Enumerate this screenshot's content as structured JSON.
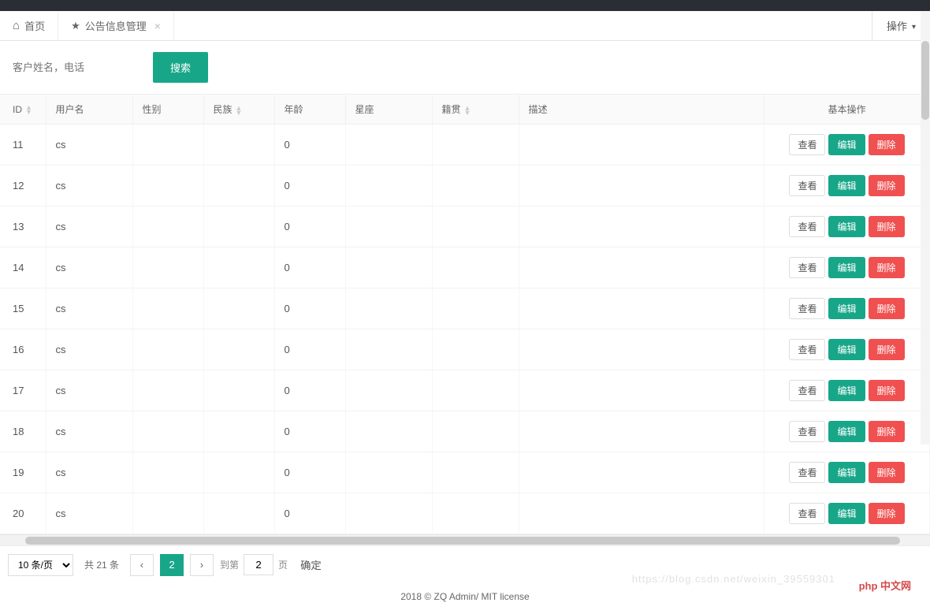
{
  "tabs": {
    "home": "首页",
    "active": "公告信息管理"
  },
  "operation_btn": "操作",
  "search": {
    "placeholder": "客户姓名，电话",
    "button": "搜索"
  },
  "columns": {
    "id": "ID",
    "username": "用户名",
    "gender": "性别",
    "ethnic": "民族",
    "age": "年龄",
    "zodiac": "星座",
    "origin": "籍贯",
    "desc": "描述",
    "ops": "基本操作"
  },
  "rows": [
    {
      "id": "11",
      "username": "cs",
      "gender": "",
      "ethnic": "",
      "age": "0",
      "zodiac": "",
      "origin": "",
      "desc": ""
    },
    {
      "id": "12",
      "username": "cs",
      "gender": "",
      "ethnic": "",
      "age": "0",
      "zodiac": "",
      "origin": "",
      "desc": ""
    },
    {
      "id": "13",
      "username": "cs",
      "gender": "",
      "ethnic": "",
      "age": "0",
      "zodiac": "",
      "origin": "",
      "desc": ""
    },
    {
      "id": "14",
      "username": "cs",
      "gender": "",
      "ethnic": "",
      "age": "0",
      "zodiac": "",
      "origin": "",
      "desc": ""
    },
    {
      "id": "15",
      "username": "cs",
      "gender": "",
      "ethnic": "",
      "age": "0",
      "zodiac": "",
      "origin": "",
      "desc": ""
    },
    {
      "id": "16",
      "username": "cs",
      "gender": "",
      "ethnic": "",
      "age": "0",
      "zodiac": "",
      "origin": "",
      "desc": ""
    },
    {
      "id": "17",
      "username": "cs",
      "gender": "",
      "ethnic": "",
      "age": "0",
      "zodiac": "",
      "origin": "",
      "desc": ""
    },
    {
      "id": "18",
      "username": "cs",
      "gender": "",
      "ethnic": "",
      "age": "0",
      "zodiac": "",
      "origin": "",
      "desc": ""
    },
    {
      "id": "19",
      "username": "cs",
      "gender": "",
      "ethnic": "",
      "age": "0",
      "zodiac": "",
      "origin": "",
      "desc": ""
    },
    {
      "id": "20",
      "username": "cs",
      "gender": "",
      "ethnic": "",
      "age": "0",
      "zodiac": "",
      "origin": "",
      "desc": ""
    }
  ],
  "action_labels": {
    "view": "查看",
    "edit": "编辑",
    "delete": "删除"
  },
  "pagination": {
    "page_size_label": "10 条/页",
    "total_label": "共 21 条",
    "current_page": "2",
    "jump_prefix": "到第",
    "jump_value": "2",
    "jump_suffix": "页",
    "confirm": "确定"
  },
  "footer": "2018 © ZQ Admin/ MIT license",
  "watermark_brand": "php 中文网",
  "watermark_url": "https://blog.csdn.net/weixin_39559301"
}
